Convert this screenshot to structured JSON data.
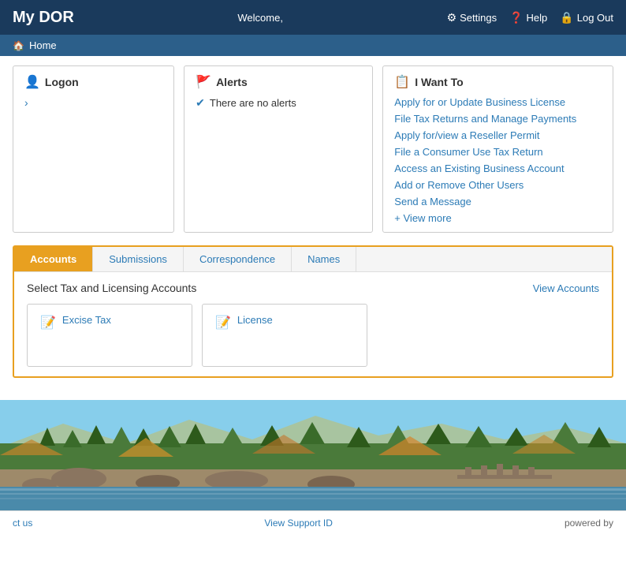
{
  "header": {
    "title": "My DOR",
    "welcome": "Welcome,",
    "settings_label": "Settings",
    "help_label": "Help",
    "logout_label": "Log Out"
  },
  "breadcrumb": {
    "home_label": "Home"
  },
  "logon_panel": {
    "title": "Logon",
    "icon": "👤"
  },
  "alerts_panel": {
    "title": "Alerts",
    "icon": "🚩",
    "message": "There are no alerts"
  },
  "iwantto_panel": {
    "title": "I Want To",
    "icon": "📋",
    "links": [
      "Apply for or Update Business License",
      "File Tax Returns and Manage Payments",
      "Apply for/view a Reseller Permit",
      "File a Consumer Use Tax Return",
      "Access an Existing Business Account",
      "Add or Remove Other Users",
      "Send a Message",
      "+ View more"
    ]
  },
  "tabs": {
    "items": [
      "Accounts",
      "Submissions",
      "Correspondence",
      "Names"
    ],
    "active": "Accounts"
  },
  "accounts_section": {
    "title": "Select Tax and Licensing Accounts",
    "view_link": "View Accounts",
    "cards": [
      {
        "label": "Excise Tax",
        "icon": "📝"
      },
      {
        "label": "License",
        "icon": "📝"
      }
    ]
  },
  "footer": {
    "contact_label": "ct us",
    "support_label": "View Support ID",
    "powered_label": "powered by"
  }
}
